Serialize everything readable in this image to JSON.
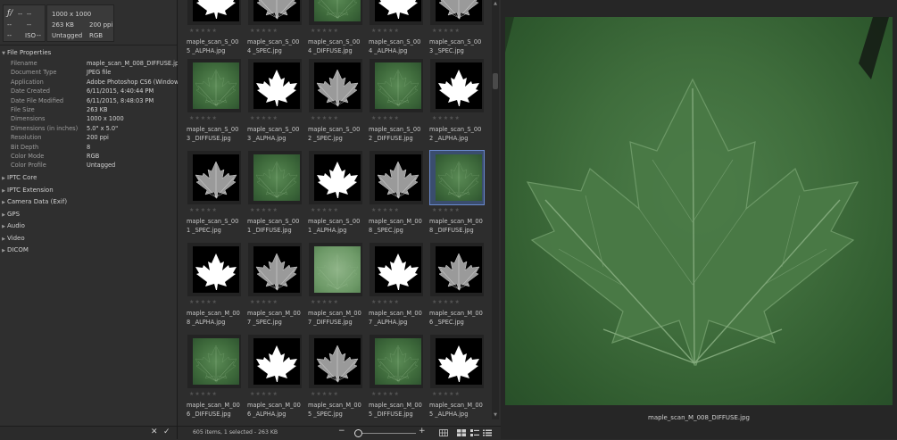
{
  "camera": {
    "aperture_icon": "f-stop-icon",
    "aperture": "--",
    "shutter": "--",
    "focal": "--",
    "exposure": "--",
    "iso_label": "ISO",
    "iso": "--"
  },
  "file_summary": {
    "dimensions": "1000 x 1000",
    "size": "263 KB",
    "resolution": "200 ppi",
    "profile": "Untagged",
    "mode": "RGB"
  },
  "sections": {
    "file_properties": "File Properties",
    "iptc_core": "IPTC Core",
    "iptc_extension": "IPTC Extension",
    "camera_data": "Camera Data (Exif)",
    "gps": "GPS",
    "audio": "Audio",
    "video": "Video",
    "dicom": "DICOM"
  },
  "properties": [
    {
      "k": "Filename",
      "v": "maple_scan_M_008_DIFFUSE.jpg"
    },
    {
      "k": "Document Type",
      "v": "JPEG file"
    },
    {
      "k": "Application",
      "v": "Adobe Photoshop CS6 (Windows)"
    },
    {
      "k": "Date Created",
      "v": "6/11/2015, 4:40:44 PM"
    },
    {
      "k": "Date File Modified",
      "v": "6/11/2015, 8:48:03 PM"
    },
    {
      "k": "File Size",
      "v": "263 KB"
    },
    {
      "k": "Dimensions",
      "v": "1000 x 1000"
    },
    {
      "k": "Dimensions (in inches)",
      "v": "5.0\" x 5.0\""
    },
    {
      "k": "Resolution",
      "v": "200 ppi"
    },
    {
      "k": "Bit Depth",
      "v": "8"
    },
    {
      "k": "Color Mode",
      "v": "RGB"
    },
    {
      "k": "Color Profile",
      "v": "Untagged"
    }
  ],
  "left_bottom": {
    "cancel_icon": "close-icon",
    "apply_icon": "checkmark-icon",
    "cancel": "✕",
    "apply": "✓"
  },
  "grid": {
    "stars": "★★★★★",
    "rows": [
      {
        "items": [
          {
            "name": "maple_scan_S_005 _ALPHA.jpg",
            "kind": "alpha"
          },
          {
            "name": "maple_scan_S_004 _SPEC.jpg",
            "kind": "spec"
          },
          {
            "name": "maple_scan_S_004 _DIFFUSE.jpg",
            "kind": "diffuse"
          },
          {
            "name": "maple_scan_S_004 _ALPHA.jpg",
            "kind": "alpha"
          },
          {
            "name": "maple_scan_S_003 _SPEC.jpg",
            "kind": "spec"
          }
        ]
      },
      {
        "items": [
          {
            "name": "maple_scan_S_003 _DIFFUSE.jpg",
            "kind": "diffuse"
          },
          {
            "name": "maple_scan_S_003 _ALPHA.jpg",
            "kind": "alpha"
          },
          {
            "name": "maple_scan_S_002 _SPEC.jpg",
            "kind": "spec"
          },
          {
            "name": "maple_scan_S_002 _DIFFUSE.jpg",
            "kind": "diffuse"
          },
          {
            "name": "maple_scan_S_002 _ALPHA.jpg",
            "kind": "alpha"
          }
        ]
      },
      {
        "items": [
          {
            "name": "maple_scan_S_001 _SPEC.jpg",
            "kind": "spec"
          },
          {
            "name": "maple_scan_S_001 _DIFFUSE.jpg",
            "kind": "diffuse"
          },
          {
            "name": "maple_scan_S_001 _ALPHA.jpg",
            "kind": "alpha"
          },
          {
            "name": "maple_scan_M_008 _SPEC.jpg",
            "kind": "spec"
          },
          {
            "name": "maple_scan_M_008 _DIFFUSE.jpg",
            "kind": "diffuse",
            "selected": true
          }
        ]
      },
      {
        "items": [
          {
            "name": "maple_scan_M_008 _ALPHA.jpg",
            "kind": "alpha"
          },
          {
            "name": "maple_scan_M_007 _SPEC.jpg",
            "kind": "spec"
          },
          {
            "name": "maple_scan_M_007 _DIFFUSE.jpg",
            "kind": "pale"
          },
          {
            "name": "maple_scan_M_007 _ALPHA.jpg",
            "kind": "alpha"
          },
          {
            "name": "maple_scan_M_006 _SPEC.jpg",
            "kind": "spec"
          }
        ]
      },
      {
        "items": [
          {
            "name": "maple_scan_M_006 _DIFFUSE.jpg",
            "kind": "diffuse"
          },
          {
            "name": "maple_scan_M_006 _ALPHA.jpg",
            "kind": "alpha"
          },
          {
            "name": "maple_scan_M_005 _SPEC.jpg",
            "kind": "spec"
          },
          {
            "name": "maple_scan_M_005 _DIFFUSE.jpg",
            "kind": "diffuse"
          },
          {
            "name": "maple_scan_M_005 _ALPHA.jpg",
            "kind": "alpha"
          }
        ]
      }
    ]
  },
  "status": {
    "text": "605 items, 1 selected - 263 KB",
    "zoom_minus": "−",
    "zoom_plus": "+",
    "zoom_level": 0.05
  },
  "view_icons": [
    "grid-view-icon",
    "thumbnail-view-icon",
    "details-view-icon",
    "list-view-icon"
  ],
  "preview": {
    "caption": "maple_scan_M_008_DIFFUSE.jpg"
  },
  "colors": {
    "selection": "#6a8ad0",
    "leaf_green": "#4e7f4b"
  }
}
